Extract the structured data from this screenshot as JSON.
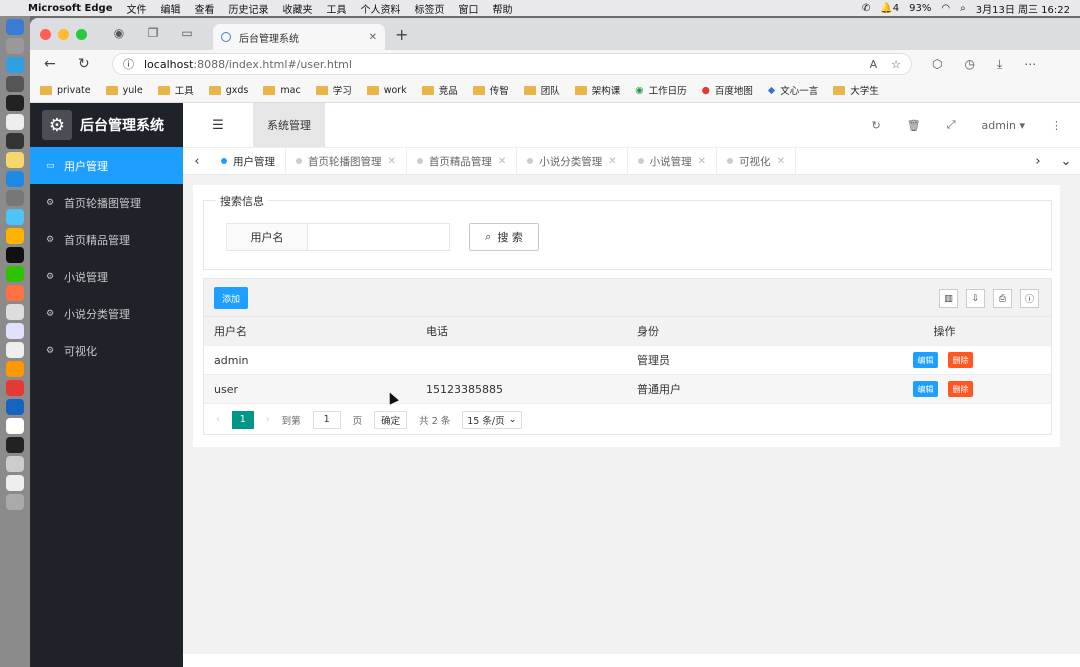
{
  "menubar": {
    "app": "Microsoft Edge",
    "menus": [
      "文件",
      "编辑",
      "查看",
      "历史记录",
      "收藏夹",
      "工具",
      "个人资料",
      "标签页",
      "窗口",
      "帮助"
    ],
    "battery": "93%",
    "notif": "4",
    "datetime": "3月13日 周三  16:22"
  },
  "browser": {
    "tab_title": "后台管理系统",
    "url_host": "localhost",
    "url_path": ":8088/index.html#/user.html"
  },
  "bookmarks": [
    "private",
    "yule",
    "工具",
    "gxds",
    "mac",
    "学习",
    "work",
    "竞品",
    "传智",
    "团队",
    "架构课",
    "工作日历",
    "百度地图",
    "文心一言",
    "大学生"
  ],
  "sidebar": {
    "title": "后台管理系统",
    "items": [
      {
        "label": "用户管理"
      },
      {
        "label": "首页轮播图管理"
      },
      {
        "label": "首页精品管理"
      },
      {
        "label": "小说管理"
      },
      {
        "label": "小说分类管理"
      },
      {
        "label": "可视化"
      }
    ]
  },
  "topbar": {
    "section": "系统管理",
    "user": "admin"
  },
  "pagetabs": [
    "用户管理",
    "首页轮播图管理",
    "首页精品管理",
    "小说分类管理",
    "小说管理",
    "可视化"
  ],
  "search": {
    "legend": "搜索信息",
    "label": "用户名",
    "value": "",
    "button": "搜 索"
  },
  "table": {
    "add_label": "添加",
    "headers": [
      "用户名",
      "电话",
      "身份",
      "操作"
    ],
    "rows": [
      {
        "username": "admin",
        "phone": "",
        "role": "管理员"
      },
      {
        "username": "user",
        "phone": "15123385885",
        "role": "普通用户"
      }
    ],
    "edit_label": "编辑",
    "delete_label": "删除"
  },
  "pager": {
    "current": "1",
    "goto_prefix": "到第",
    "goto_value": "1",
    "goto_suffix": "页",
    "confirm": "确定",
    "total": "共 2 条",
    "per_page": "15 条/页"
  },
  "colors": {
    "accent": "#1e9fff",
    "danger": "#ff5722",
    "pager_active": "#009688",
    "sidebar_bg": "#20222a"
  }
}
